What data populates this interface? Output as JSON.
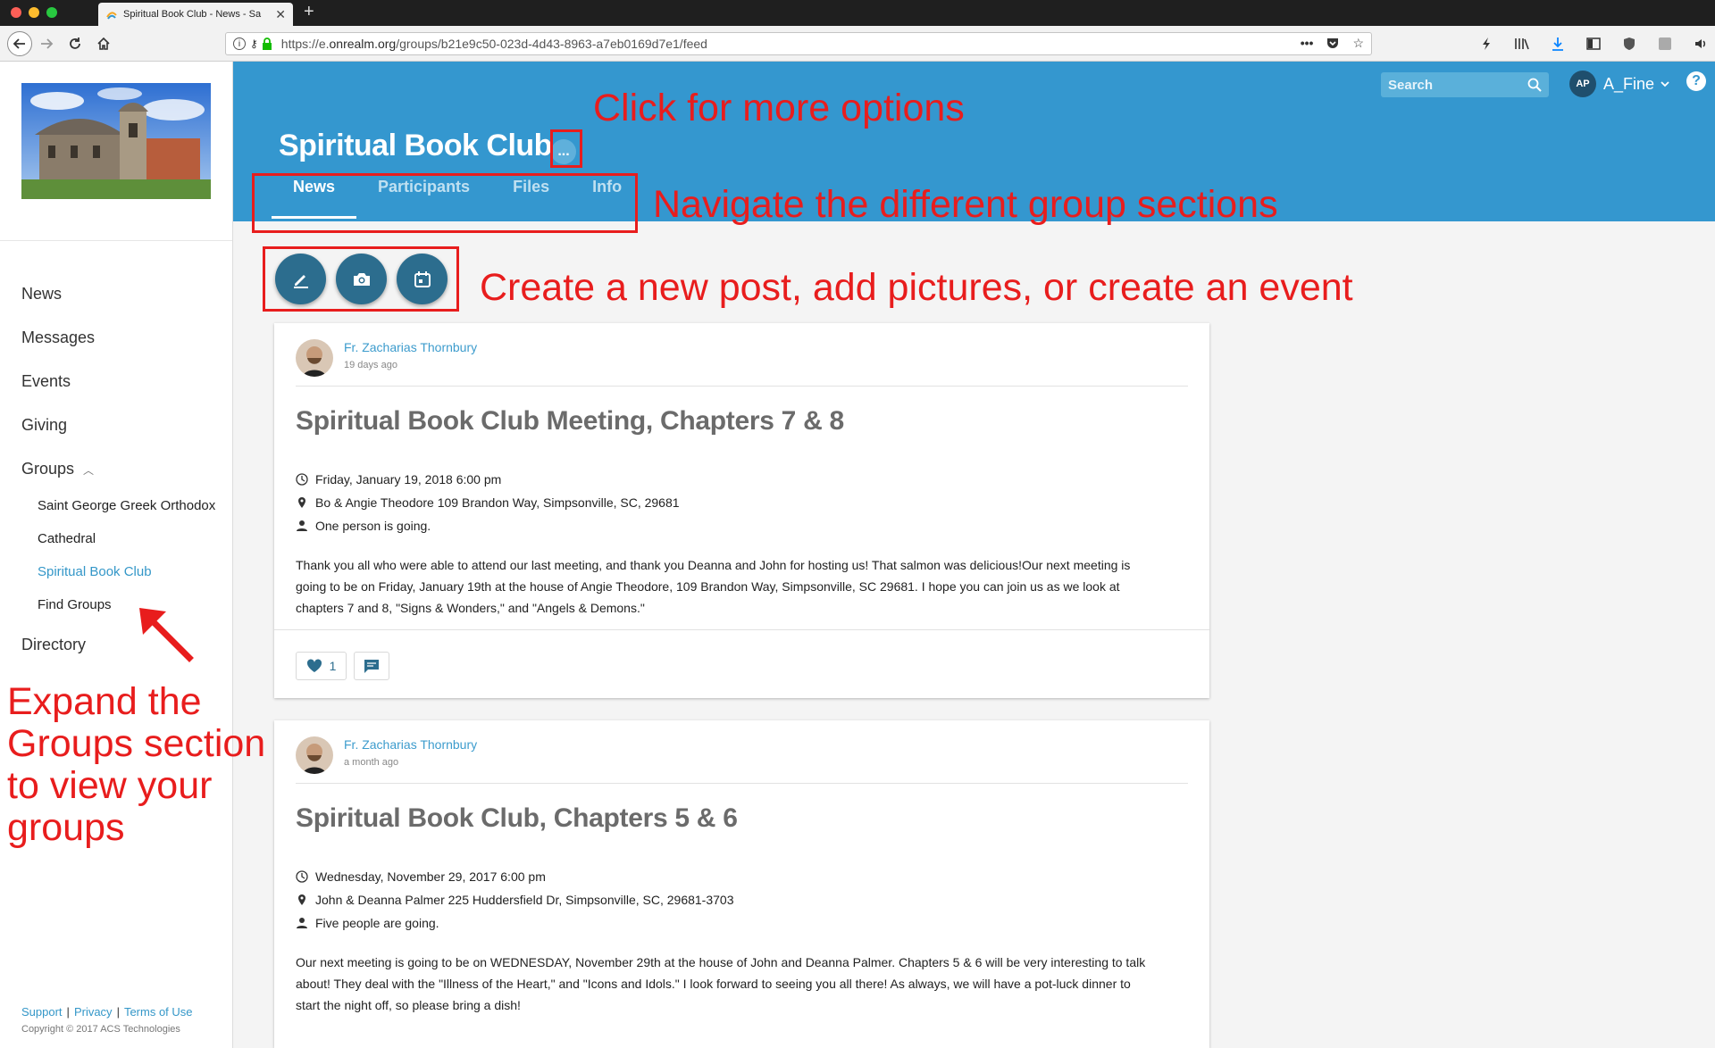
{
  "browser": {
    "tab_title": "Spiritual Book Club - News - Sa",
    "url_prefix": "https://e.",
    "url_domain": "onrealm.org",
    "url_path": "/groups/b21e9c50-023d-4d43-8963-a7eb0169d7e1/feed"
  },
  "sidebar": {
    "nav": [
      {
        "label": "News"
      },
      {
        "label": "Messages"
      },
      {
        "label": "Events"
      },
      {
        "label": "Giving"
      },
      {
        "label": "Groups"
      }
    ],
    "groups": [
      {
        "label": "Saint George Greek Orthodox"
      },
      {
        "label": "Cathedral"
      },
      {
        "label": "Spiritual Book Club"
      },
      {
        "label": "Find Groups"
      }
    ],
    "directory": "Directory",
    "footer": {
      "support": "Support",
      "privacy": "Privacy",
      "terms": "Terms of Use",
      "copyright": "Copyright © 2017 ACS Technologies"
    }
  },
  "header": {
    "search_placeholder": "Search",
    "user_initials": "AP",
    "user_name": "A_Fine",
    "help": "?",
    "group_title": "Spiritual Book Club",
    "more": "...",
    "tabs": [
      {
        "label": "News"
      },
      {
        "label": "Participants"
      },
      {
        "label": "Files"
      },
      {
        "label": "Info"
      }
    ]
  },
  "annotations": {
    "more_options": "Click for more options",
    "navigate": "Navigate the different group sections",
    "create": "Create a new post, add pictures, or create an event",
    "expand_lines": [
      "Expand the",
      "Groups section",
      "to view your",
      "groups"
    ]
  },
  "posts": [
    {
      "author": "Fr. Zacharias Thornbury",
      "time": "19 days ago",
      "title": "Spiritual Book Club Meeting, Chapters 7 & 8",
      "date": "Friday, January 19, 2018 6:00 pm",
      "location": "Bo & Angie Theodore  109 Brandon Way, Simpsonville, SC, 29681",
      "attending": "One person is going.",
      "body_lines": [
        "Thank you all who were able to attend our last meeting, and thank you Deanna and John for hosting us! That salmon was delicious!Our next meeting is",
        "going to be on Friday, January 19th at the house of Angie Theodore, 109 Brandon Way, Simpsonville, SC 29681. I hope you can join us as we look at",
        "chapters 7 and 8, \"Signs & Wonders,\" and \"Angels & Demons.\""
      ],
      "likes": "1"
    },
    {
      "author": "Fr. Zacharias Thornbury",
      "time": "a month ago",
      "title": "Spiritual Book Club, Chapters 5 & 6",
      "date": "Wednesday, November 29, 2017 6:00 pm",
      "location": "John & Deanna Palmer  225 Huddersfield Dr, Simpsonville, SC, 29681-3703",
      "attending": "Five people are going.",
      "body_lines": [
        "Our next meeting is going to be on WEDNESDAY, November 29th at the house of John and Deanna Palmer. Chapters 5 & 6 will be very interesting to talk",
        "about! They deal with the \"Illness of the Heart,\" and \"Icons and Idols.\" I look forward to seeing you all there! As always, we will have a pot-luck dinner to",
        "start the night off, so please bring a dish!"
      ]
    }
  ],
  "colors": {
    "header_blue": "#3497cf",
    "link_blue": "#3497c8",
    "action_teal": "#2c6d8e",
    "annotation_red": "#e81d1d"
  }
}
